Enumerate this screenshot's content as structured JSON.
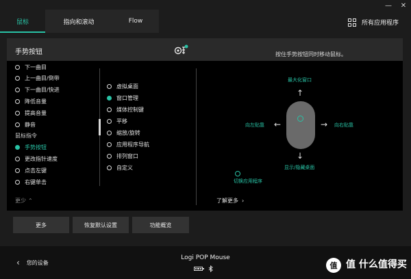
{
  "window": {
    "minimize": "—",
    "close": "✕"
  },
  "tabs": [
    {
      "label": "鼠标",
      "active": true
    },
    {
      "label": "指向和滚动",
      "active": false
    },
    {
      "label": "Flow",
      "active": false
    }
  ],
  "apps_label": "所有应用程序",
  "panel": {
    "title": "手势按钮",
    "hint": "按住手势按钮同时移动鼠标。",
    "col1": [
      {
        "label": "下一曲目",
        "type": "radio"
      },
      {
        "label": "上一曲目/倒带",
        "type": "radio"
      },
      {
        "label": "下一曲目/快进",
        "type": "radio"
      },
      {
        "label": "降低音量",
        "type": "radio"
      },
      {
        "label": "提高音量",
        "type": "radio"
      },
      {
        "label": "静音",
        "type": "radio"
      },
      {
        "label": "鼠标指令",
        "type": "section"
      },
      {
        "label": "手势按钮",
        "type": "radio",
        "active": true
      },
      {
        "label": "更改指针速度",
        "type": "radio"
      },
      {
        "label": "点击左键",
        "type": "radio"
      },
      {
        "label": "右键单击",
        "type": "radio"
      }
    ],
    "less_label": "更少",
    "col2": [
      {
        "label": "虚拟桌面",
        "active": false
      },
      {
        "label": "窗口管理",
        "active": true
      },
      {
        "label": "媒体控制键",
        "active": false
      },
      {
        "label": "平移",
        "active": false
      },
      {
        "label": "缩放/旋转",
        "active": false
      },
      {
        "label": "应用程序导航",
        "active": false
      },
      {
        "label": "排列窗口",
        "active": false
      },
      {
        "label": "自定义",
        "active": false
      }
    ],
    "diagram": {
      "up": "最大化窗口",
      "left": "向左贴靠",
      "right": "向右贴靠",
      "down": "显示/隐藏桌面",
      "click": "切换应用程序"
    },
    "learn_more": "了解更多"
  },
  "buttons": {
    "more": "更多",
    "reset": "恢复默认设置",
    "overview": "功能概览"
  },
  "footer": {
    "back_label": "您的设备",
    "device_name": "Logi POP Mouse",
    "watermark": "值 什么值得买"
  },
  "colors": {
    "accent": "#29c3a6",
    "panel_bg": "#000000",
    "app_bg": "#1c1c1c"
  }
}
